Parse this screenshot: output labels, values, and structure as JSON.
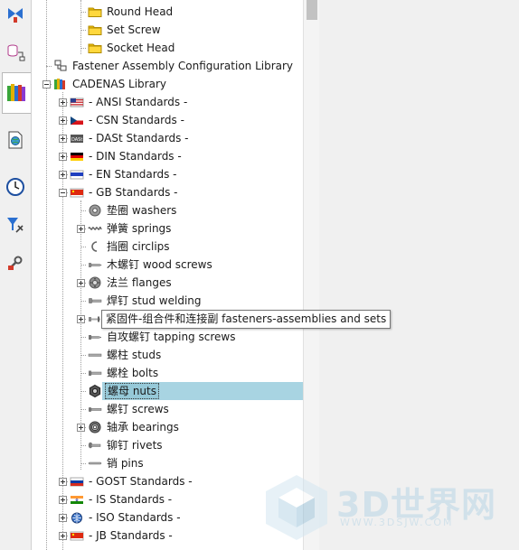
{
  "taskbar": {
    "buttons": [
      {
        "icon": "assembly-icon"
      },
      {
        "icon": "database-icon"
      },
      {
        "icon": "library-books-icon",
        "active": true
      },
      {
        "icon": "document-globe-icon"
      },
      {
        "icon": "clock-icon"
      },
      {
        "icon": "filter-tools-icon"
      },
      {
        "icon": "wrench-tools-icon"
      }
    ]
  },
  "tree": {
    "rows": [
      {
        "label": "Round Head",
        "level": 3,
        "icon": "folder-icon"
      },
      {
        "label": "Set Screw",
        "level": 3,
        "icon": "folder-icon"
      },
      {
        "label": "Socket Head",
        "level": 3,
        "icon": "folder-icon"
      },
      {
        "label": "Fastener Assembly Configuration Library",
        "level": 1,
        "icon": "config-library-icon"
      },
      {
        "label": "CADENAS Library",
        "level": 1,
        "icon": "books-icon",
        "toggle": "minus"
      },
      {
        "label": "- ANSI Standards -",
        "level": 2,
        "icon": "flag-us-icon",
        "toggle": "plus"
      },
      {
        "label": "- CSN Standards -",
        "level": 2,
        "icon": "flag-cz-icon",
        "toggle": "plus"
      },
      {
        "label": "- DASt Standards -",
        "level": 2,
        "icon": "dast-icon",
        "toggle": "plus"
      },
      {
        "label": "- DIN Standards -",
        "level": 2,
        "icon": "flag-de-icon",
        "toggle": "plus"
      },
      {
        "label": "- EN Standards -",
        "level": 2,
        "icon": "flag-eu-icon",
        "toggle": "plus"
      },
      {
        "label": "- GB Standards -",
        "level": 2,
        "icon": "flag-cn-icon",
        "toggle": "minus"
      },
      {
        "label": "垫圈 washers",
        "level": 3,
        "icon": "washer-icon"
      },
      {
        "label": "弹簧 springs",
        "level": 3,
        "icon": "spring-icon",
        "toggle": "plus"
      },
      {
        "label": "挡圈 circlips",
        "level": 3,
        "icon": "circlip-icon"
      },
      {
        "label": "木螺钉 wood screws",
        "level": 3,
        "icon": "wood-screw-icon"
      },
      {
        "label": "法兰 flanges",
        "level": 3,
        "icon": "flange-icon",
        "toggle": "plus"
      },
      {
        "label": "焊钉 stud welding",
        "level": 3,
        "icon": "stud-weld-icon"
      },
      {
        "label": "紧固件-组合件和连接副 fasteners-assemblies and sets",
        "level": 3,
        "icon": "assembly-set-icon",
        "toggle": "plus",
        "hidden_by_tooltip": true
      },
      {
        "label": "自攻螺钉 tapping screws",
        "level": 3,
        "icon": "tapping-screw-icon"
      },
      {
        "label": "螺柱 studs",
        "level": 3,
        "icon": "stud-icon"
      },
      {
        "label": "螺栓 bolts",
        "level": 3,
        "icon": "bolt-icon"
      },
      {
        "label": "螺母 nuts",
        "level": 3,
        "icon": "nut-icon",
        "selected": true
      },
      {
        "label": "螺钉 screws",
        "level": 3,
        "icon": "screw-icon"
      },
      {
        "label": "轴承 bearings",
        "level": 3,
        "icon": "bearing-icon",
        "toggle": "plus"
      },
      {
        "label": "铆钉 rivets",
        "level": 3,
        "icon": "rivet-icon"
      },
      {
        "label": "销 pins",
        "level": 3,
        "icon": "pin-icon"
      },
      {
        "label": "- GOST Standards -",
        "level": 2,
        "icon": "flag-ru-icon",
        "toggle": "plus"
      },
      {
        "label": "- IS Standards -",
        "level": 2,
        "icon": "flag-in-icon",
        "toggle": "plus"
      },
      {
        "label": "- ISO Standards -",
        "level": 2,
        "icon": "iso-globe-icon",
        "toggle": "plus"
      },
      {
        "label": "- JB Standards -",
        "level": 2,
        "icon": "flag-cn-icon",
        "toggle": "plus"
      }
    ]
  },
  "tooltip": {
    "text": "紧固件-组合件和连接副 fasteners-assemblies and sets"
  },
  "watermark": {
    "title": "3D世界网",
    "url": "WWW.3DSJW.COM"
  },
  "colors": {
    "selection": "#96c9d8",
    "folder": "#f5c400",
    "tree_bg": "#ffffff"
  }
}
